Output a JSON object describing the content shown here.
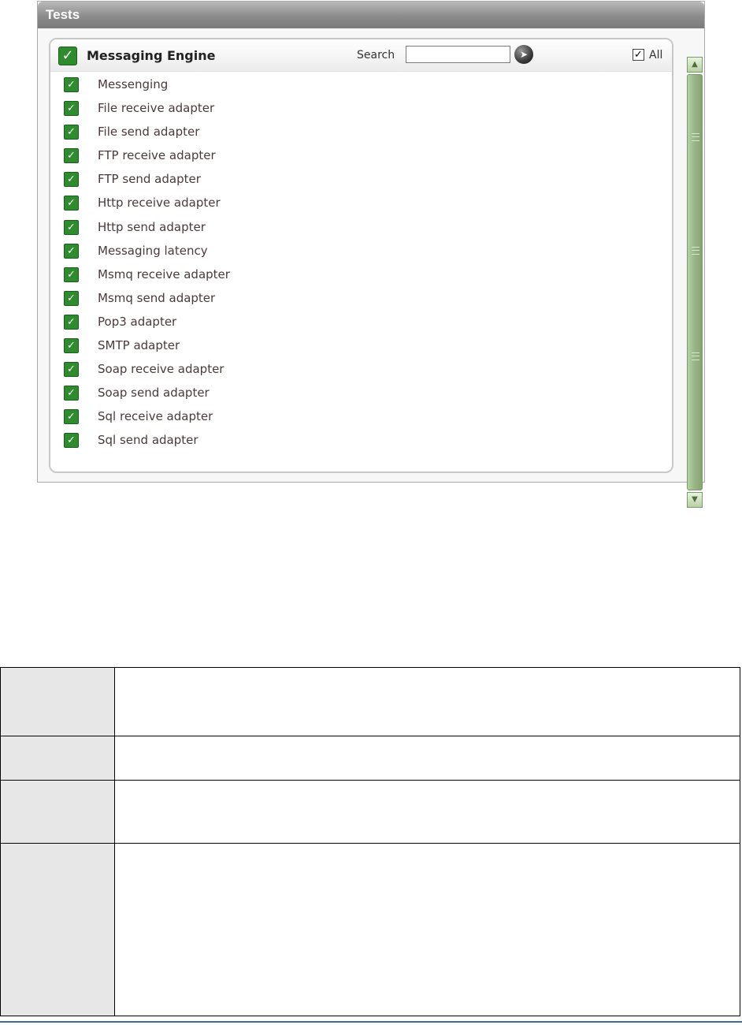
{
  "window": {
    "title": "Tests"
  },
  "panel": {
    "title": "Messaging Engine",
    "search_label": "Search",
    "search_value": "",
    "all_label": "All",
    "all_checked": true
  },
  "tests": [
    "Messenging",
    "File receive adapter",
    "File send adapter",
    "FTP receive adapter",
    "FTP send adapter",
    "Http receive adapter",
    "Http send adapter",
    "Messaging latency",
    "Msmq receive adapter",
    "Msmq send adapter",
    "Pop3 adapter",
    "SMTP adapter",
    "Soap receive adapter",
    "Soap send adapter",
    "Sql receive adapter",
    "Sql send adapter"
  ],
  "icons": {
    "check": "checkmark-icon",
    "go": "arrow-right-circle-icon",
    "scroll_up": "chevron-up-icon",
    "scroll_down": "chevron-down-icon"
  },
  "colors": {
    "check_green": "#2e8b2e",
    "header_gray": "#8c8c8c",
    "scrollbar_green": "#97b584",
    "footer_blue": "#3e6aa5"
  },
  "table": {
    "rows": 4,
    "cells": [
      [
        "",
        ""
      ],
      [
        "",
        ""
      ],
      [
        "",
        ""
      ],
      [
        "",
        ""
      ]
    ]
  }
}
